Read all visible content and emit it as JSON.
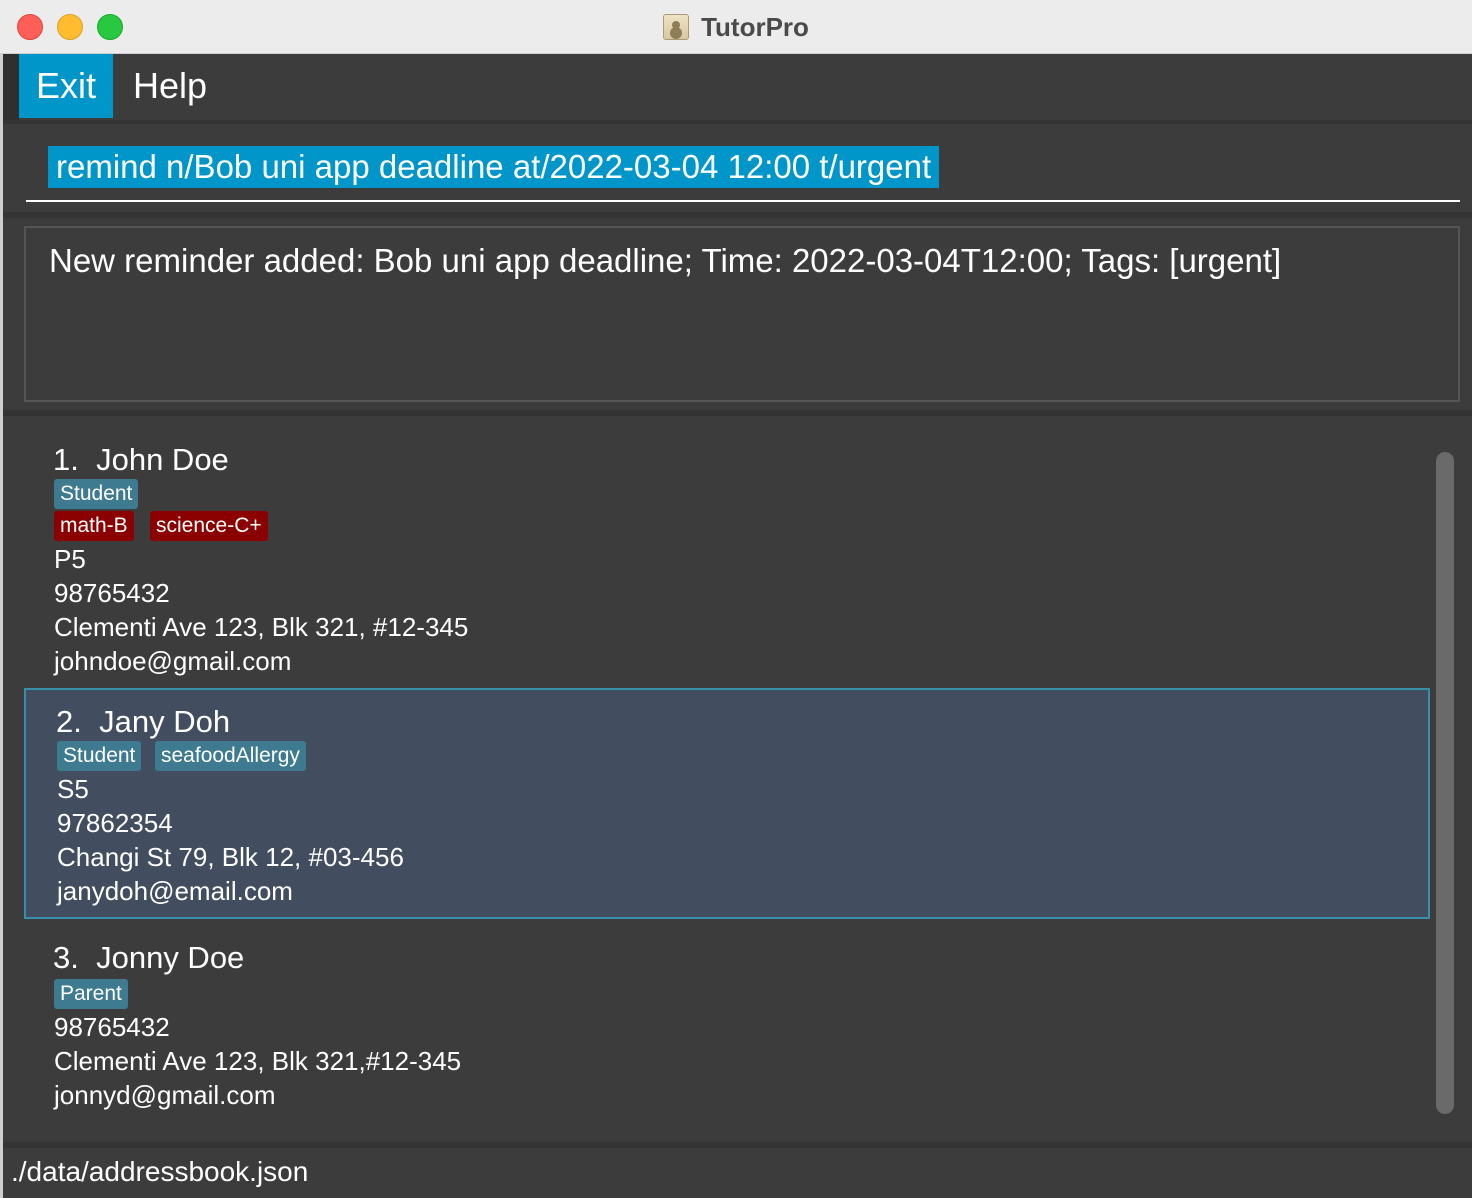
{
  "window": {
    "title": "TutorPro"
  },
  "menu": {
    "exit_label": "Exit",
    "help_label": "Help"
  },
  "command": {
    "value": "remind n/Bob uni app deadline at/2022-03-04 12:00 t/urgent"
  },
  "result": {
    "text": "New reminder added: Bob uni app deadline; Time: 2022-03-04T12:00; Tags: [urgent]"
  },
  "persons": [
    {
      "index": "1.",
      "name": "John Doe",
      "role_tags": [
        "Student"
      ],
      "grade_tags": [
        "math-B",
        "science-C+"
      ],
      "level": "P5",
      "phone": "98765432",
      "address": "Clementi Ave 123, Blk 321, #12-345",
      "email": "johndoe@gmail.com"
    },
    {
      "index": "2.",
      "name": "Jany Doh",
      "role_tags": [
        "Student",
        "seafoodAllergy"
      ],
      "level": "S5",
      "phone": "97862354",
      "address": "Changi St 79, Blk 12, #03-456",
      "email": "janydoh@email.com"
    },
    {
      "index": "3.",
      "name": "Jonny Doe",
      "role_tags": [
        "Parent"
      ],
      "phone": "98765432",
      "address": "Clementi Ave 123, Blk 321,#12-345",
      "email": "jonnyd@gmail.com"
    }
  ],
  "status": {
    "file_path": "./data/addressbook.json"
  },
  "colors": {
    "accent": "#0096c9",
    "background": "#3c3c3c",
    "role_tag": "#3e7b91",
    "grade_tag": "#8b0000",
    "selected_card": "#424d5f"
  }
}
